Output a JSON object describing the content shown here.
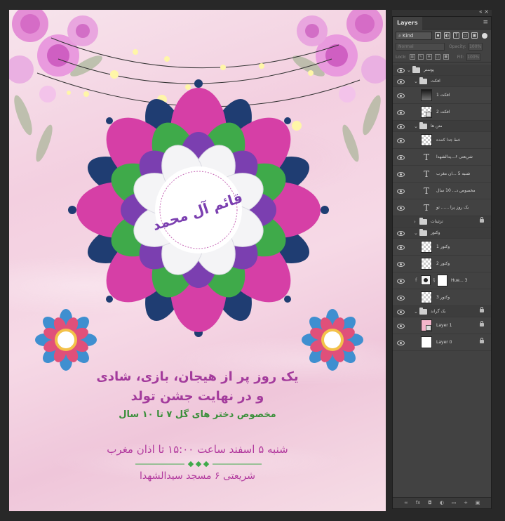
{
  "poster": {
    "line1": "یک روز پر از هیجان، بازی، شادی",
    "line2": "و در نهایت جشن تولد",
    "line3": "مخصوص دختر های گل ۷ تا ۱۰ سال",
    "line4": "شنبه ۵ اسفند ساعت ۱۵:۰۰ تا اذان مغرب",
    "line5": "شریعتی ۶ مسجد سیدالشهدا",
    "calligraphy": "قائم آل محمد",
    "colors": {
      "magenta": "#d63fa6",
      "green": "#3faa4a",
      "navy": "#1f3d72",
      "purple": "#7b3fb0",
      "text_magenta": "#a33b9c",
      "text_green": "#3a8f3a"
    }
  },
  "panel": {
    "tab": "Layers",
    "collapse_glyph": "«",
    "close_glyph": "×",
    "menu_glyph": "≡",
    "kind": "Kind",
    "blend_mode": "Normal",
    "opacity_label": "Opacity:",
    "opacity_value": "100%",
    "lock_label": "Lock:",
    "fill_label": "Fill:",
    "fill_value": "100%",
    "layers": {
      "g_poster": "پوستر",
      "g_effect": "افکت",
      "effect1": "افکت 1",
      "effect2": "افکت 2",
      "g_text": "متن ها",
      "divider": "خط جدا کننده",
      "txt_address": "شریعتی ۶...یدالشهدا",
      "txt_date": "شنبه 5 ...ان مغرب",
      "txt_age": "مخصوص د... 10 سال",
      "txt_day": "یک روز پرا ...... تو",
      "g_ornaments": "تزئینات",
      "g_vector": "وکتور",
      "vector1": "وکتور 1",
      "vector2": "وکتور 2",
      "hue": "Hue... 3",
      "vector_small": "وکتور 3",
      "g_background": "بک گراند",
      "layer1": "Layer 1",
      "layer0": "Layer 0",
      "t_glyph": "T",
      "fx_glyph": "f",
      "link_glyph": "§"
    },
    "footer_icons": [
      "link-icon",
      "fx-icon",
      "mask-icon",
      "adjustment-icon",
      "folder-icon",
      "new-layer-icon",
      "trash-icon"
    ],
    "footer_glyphs": [
      "∞",
      "fx",
      "◘",
      "◐",
      "▭",
      "+",
      "▣"
    ]
  }
}
